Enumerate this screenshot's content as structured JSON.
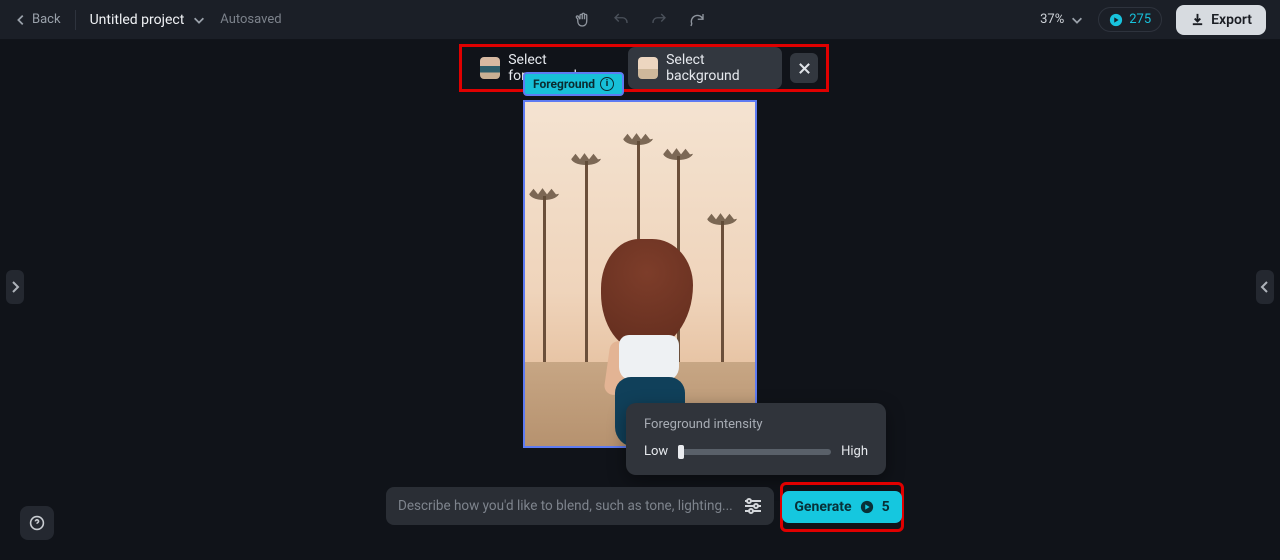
{
  "topbar": {
    "back": "Back",
    "project_name": "Untitled project",
    "autosaved": "Autosaved",
    "zoom": "37%",
    "credits": "275",
    "export": "Export"
  },
  "selector": {
    "foreground": "Select foreground",
    "background": "Select background"
  },
  "badge": {
    "label": "Foreground"
  },
  "intensity": {
    "title": "Foreground intensity",
    "low": "Low",
    "high": "High"
  },
  "prompt": {
    "placeholder": "Describe how you'd like to blend, such as tone, lighting..."
  },
  "generate": {
    "label": "Generate",
    "cost": "5"
  }
}
